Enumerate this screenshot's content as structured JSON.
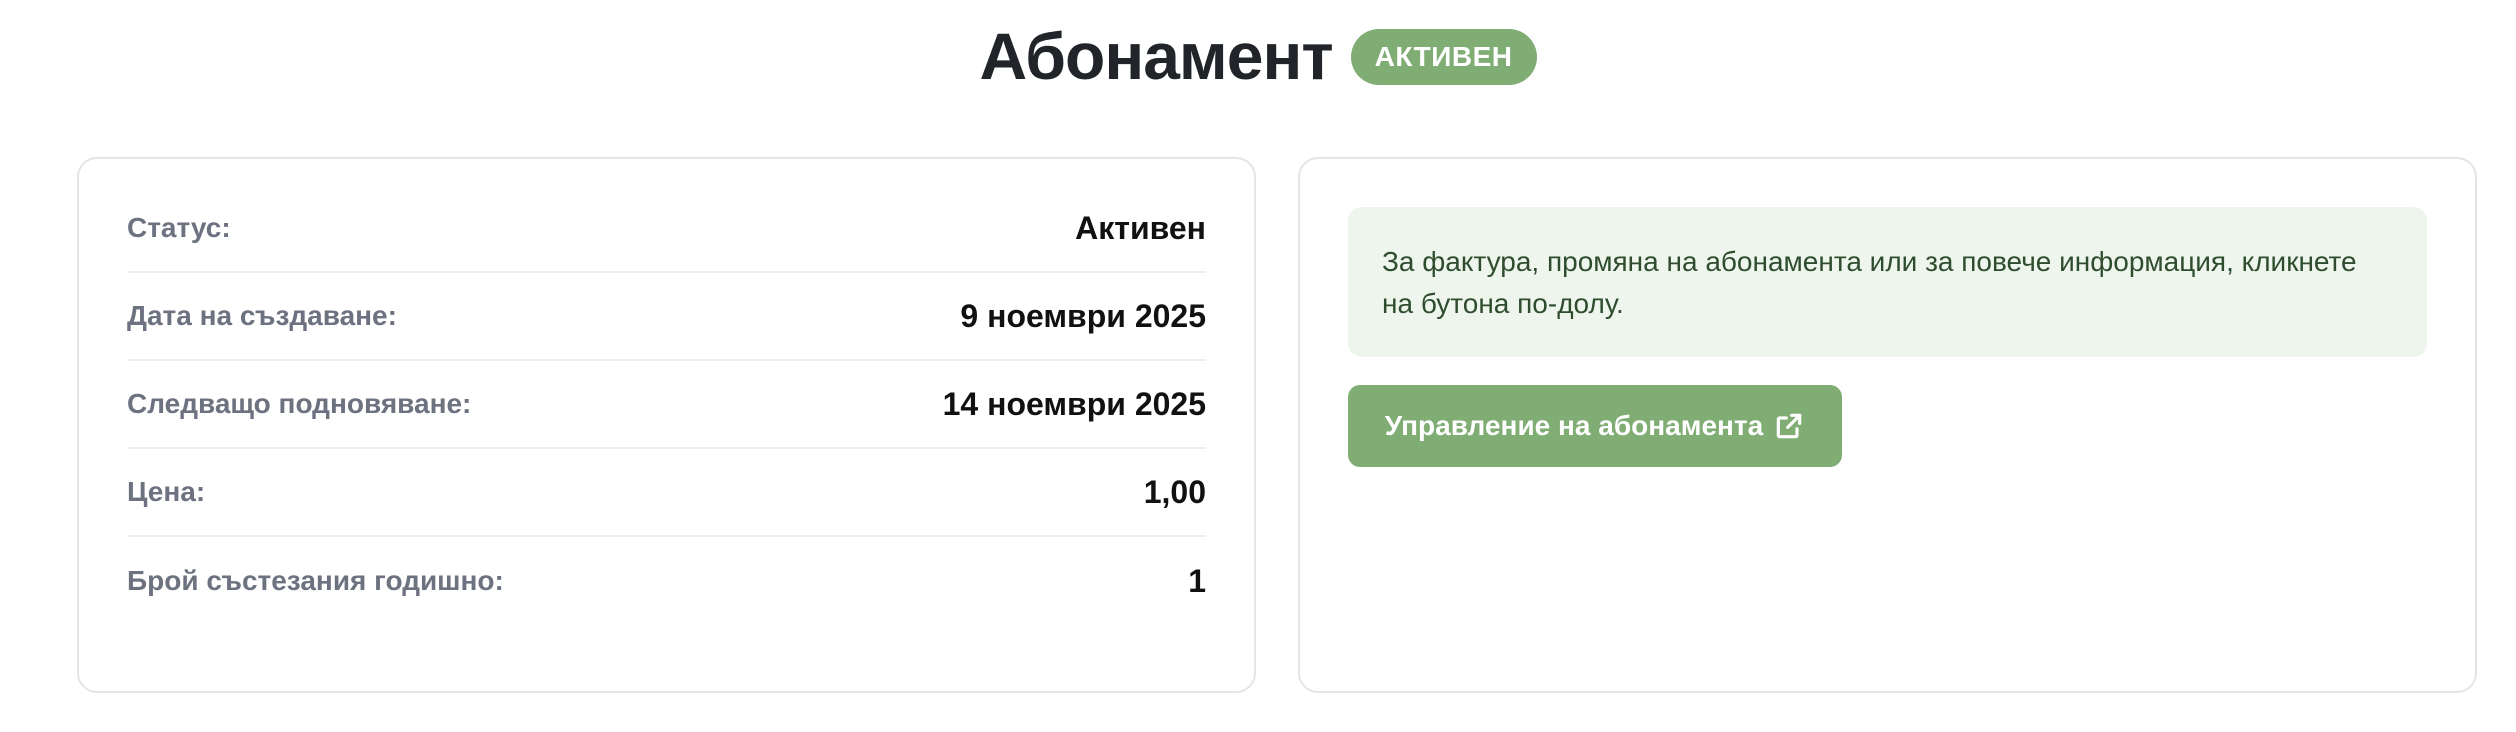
{
  "header": {
    "title": "Абонамент",
    "status_badge": "АКТИВЕН"
  },
  "details": {
    "rows": [
      {
        "label": "Статус:",
        "value": "Активен"
      },
      {
        "label": "Дата на създаване:",
        "value": "9 ноември 2025"
      },
      {
        "label": "Следващо подновяване:",
        "value": "14 ноември 2025"
      },
      {
        "label": "Цена:",
        "value": "1,00"
      },
      {
        "label": "Брой състезания годишно:",
        "value": "1"
      }
    ]
  },
  "manage": {
    "info_text": "За фактура, промяна на абонамента или за повече информация, кликнете на бутона по-долу.",
    "button_label": "Управление на абонамента",
    "button_icon": "external-link-icon"
  },
  "colors": {
    "accent": "#7fad74",
    "info_bg": "#edf5ec",
    "label": "#6c727f"
  }
}
